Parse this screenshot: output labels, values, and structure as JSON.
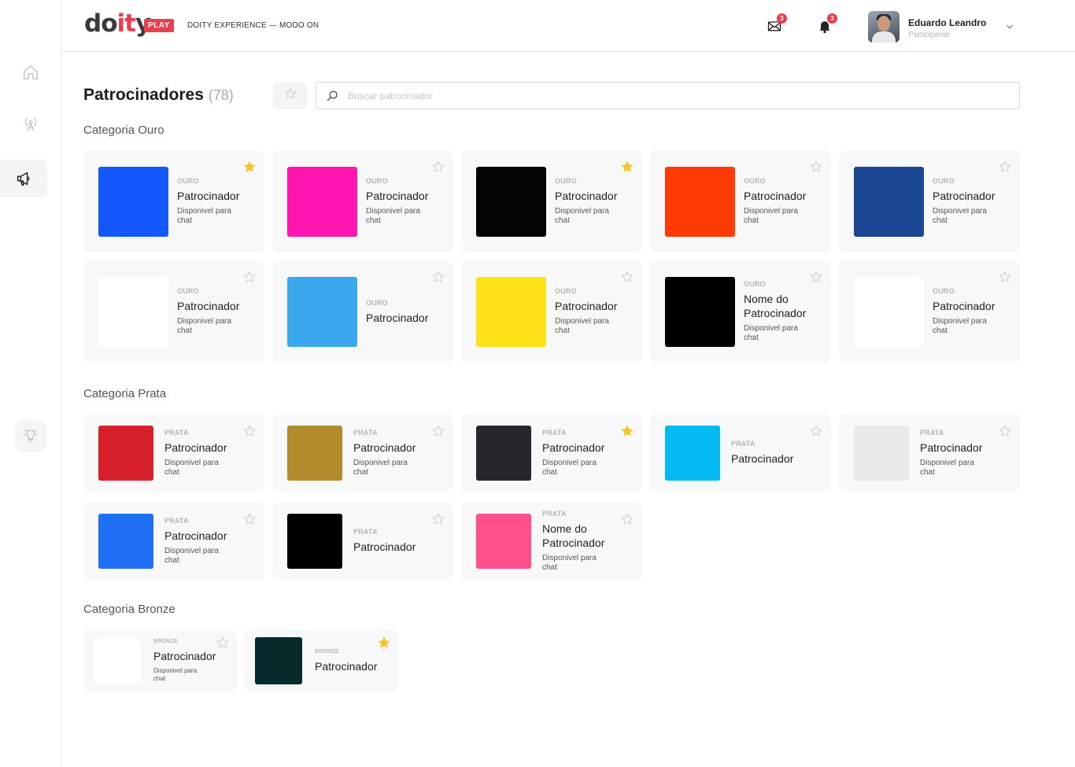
{
  "header": {
    "logo_main": "do",
    "logo_accent": "it",
    "logo_end": "y",
    "play_badge": "PLAY",
    "experience": "DOITY EXPERIENCE — MODO ON",
    "mail_count": "3",
    "bell_count": "3",
    "user_name": "Eduardo Leandro",
    "user_role": "Participante"
  },
  "page": {
    "title": "Patrocinadores",
    "count": "(78)",
    "search_placeholder": "Buscar patrocinador"
  },
  "categories": {
    "ouro": "Categoria Ouro",
    "prata": "Categoria Prata",
    "bronze": "Categoria Bronze"
  },
  "ouro_cards": [
    {
      "tier": "OURO",
      "name": "Patrocinador",
      "avail": "Disponivel para chat",
      "color": "#1458fb",
      "favorite": true
    },
    {
      "tier": "OURO",
      "name": "Patrocinador",
      "avail": "Disponivel para chat",
      "color": "#ff16b0",
      "favorite": false
    },
    {
      "tier": "OURO",
      "name": "Patrocinador",
      "avail": "Disponivel para chat",
      "color": "#060303",
      "favorite": true
    },
    {
      "tier": "OURO",
      "name": "Patrocinador",
      "avail": "Disponivel para chat",
      "color": "#ff3b05",
      "favorite": false
    },
    {
      "tier": "OURO",
      "name": "Patrocinador",
      "avail": "Disponivel para chat",
      "color": "#1b4693",
      "favorite": false
    },
    {
      "tier": "OURO",
      "name": "Patrocinador",
      "avail": "Disponivel para chat",
      "color": "#ffffff",
      "favorite": false
    },
    {
      "tier": "OURO",
      "name": "Patrocinador",
      "avail": "",
      "color": "#3aa8ec",
      "favorite": false
    },
    {
      "tier": "OURO",
      "name": "Patrocinador",
      "avail": "Disponivel para chat",
      "color": "#ffe11a",
      "favorite": false
    },
    {
      "tier": "OURO",
      "name": "Nome do Patrocinador",
      "avail": "Disponivel para chat",
      "color": "#000000",
      "favorite": false
    },
    {
      "tier": "OURO",
      "name": "Patrocinador",
      "avail": "Disponivel para chat",
      "color": "#ffffff",
      "favorite": false
    }
  ],
  "prata_cards": [
    {
      "tier": "PRATA",
      "name": "Patrocinador",
      "avail": "Disponivel para chat",
      "color": "#d8202c",
      "favorite": false
    },
    {
      "tier": "PRATA",
      "name": "Patrocinador",
      "avail": "Disponivel para chat",
      "color": "#b18b2c",
      "favorite": false
    },
    {
      "tier": "PRATA",
      "name": "Patrocinador",
      "avail": "Disponivel para chat",
      "color": "#24282c",
      "favorite": true
    },
    {
      "tier": "PRATA",
      "name": "Patrocinador",
      "avail": "",
      "color": "#04baf3",
      "favorite": false
    },
    {
      "tier": "PRATA",
      "name": "Patrocinador",
      "avail": "Disponivel para chat",
      "color": "#e9e9e9",
      "favorite": false
    },
    {
      "tier": "PRATA",
      "name": "Patrocinador",
      "avail": "Disponivel para chat",
      "color": "#1f6ff5",
      "favorite": false
    },
    {
      "tier": "PRATA",
      "name": "Patrocinador",
      "avail": "",
      "color": "#000000",
      "favorite": false
    },
    {
      "tier": "PRATA",
      "name": "Nome do Patrocinador",
      "avail": "Disponivel para chat",
      "color": "#ff4f8c",
      "favorite": false
    }
  ],
  "bronze_cards": [
    {
      "tier": "BRONZE",
      "name": "Patrocinador",
      "avail": "Disponivel para chat",
      "color": "#ffffff",
      "favorite": false
    },
    {
      "tier": "BRONZE",
      "name": "Patrocinador",
      "avail": "",
      "color": "#052a29",
      "favorite": true
    }
  ]
}
